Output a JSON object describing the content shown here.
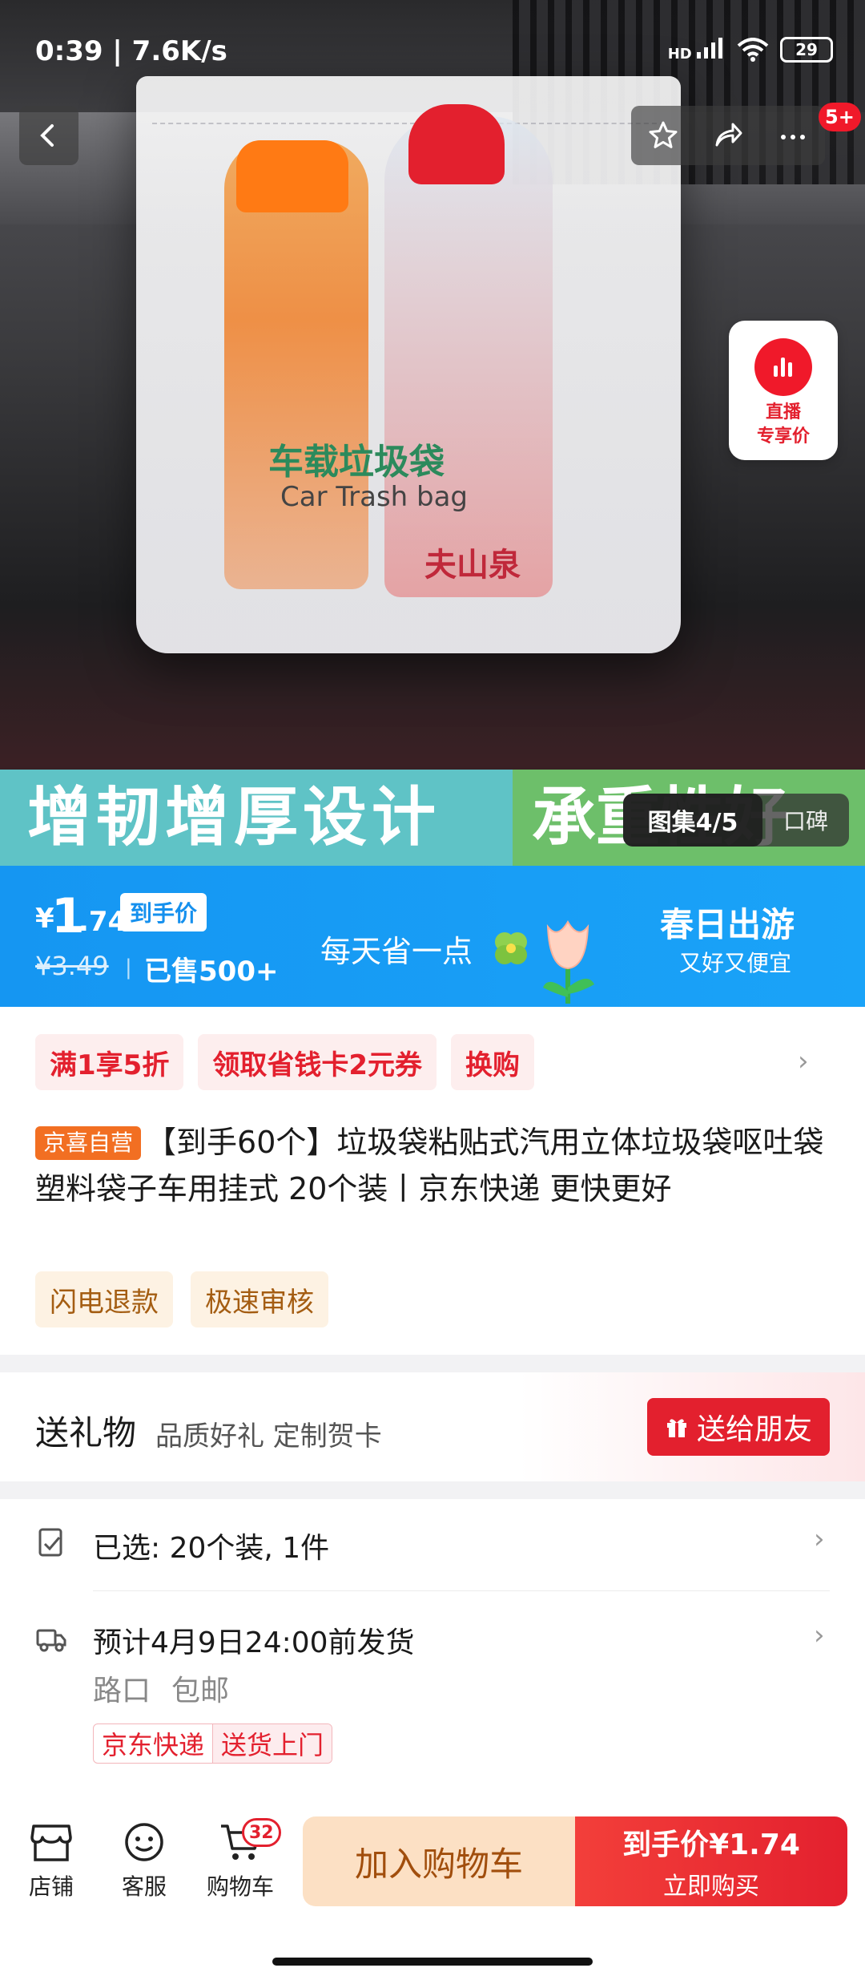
{
  "status_bar": {
    "time": "0:39",
    "speed": "7.6K/s",
    "signal": "HD",
    "battery": "29"
  },
  "nav": {
    "more_badge": "5+"
  },
  "hero": {
    "bag_text_cn": "车载垃圾袋",
    "bag_text_en": "Car Trash bag",
    "bottle_text": "夫山泉",
    "live_label_1": "直播",
    "live_label_2": "专享价",
    "banner_left": "增韧增厚设计",
    "banner_right": "承重性好",
    "album_label": "图集4/5",
    "review_label": "口碑"
  },
  "price": {
    "currency": "¥",
    "integer": "1",
    "decimal": ".74",
    "tag": "到手价",
    "original": "¥3.49",
    "sold": "已售500+",
    "slogan": "每天省一点",
    "promo_title": "春日出游",
    "promo_sub": "又好又便宜"
  },
  "coupons": [
    "满1享5折",
    "领取省钱卡2元券",
    "换购"
  ],
  "product": {
    "self_badge": "京喜自营",
    "title": "【到手60个】垃圾袋粘贴式汽用立体垃圾袋呕吐袋塑料袋子车用挂式 20个装丨京东快递 更快更好",
    "features": [
      "闪电退款",
      "极速审核"
    ]
  },
  "gift": {
    "title": "送礼物",
    "subtitle": "品质好礼 定制贺卡",
    "button": "送给朋友"
  },
  "options": {
    "selected": "已选: 20个装, 1件",
    "ship": "预计4月9日24:00前发货",
    "location": "路口",
    "shipping_fee": "包邮",
    "tag1": "京东快递",
    "tag2": "送货上门"
  },
  "bottom": {
    "shop": "店铺",
    "service": "客服",
    "cart": "购物车",
    "cart_count": "32",
    "add_cart": "加入购物车",
    "buy_line1": "到手价¥1.74",
    "buy_line2": "立即购买"
  },
  "colors": {
    "accent_red": "#e3202e",
    "price_blue": "#1596f2",
    "orange": "#f26f22"
  }
}
